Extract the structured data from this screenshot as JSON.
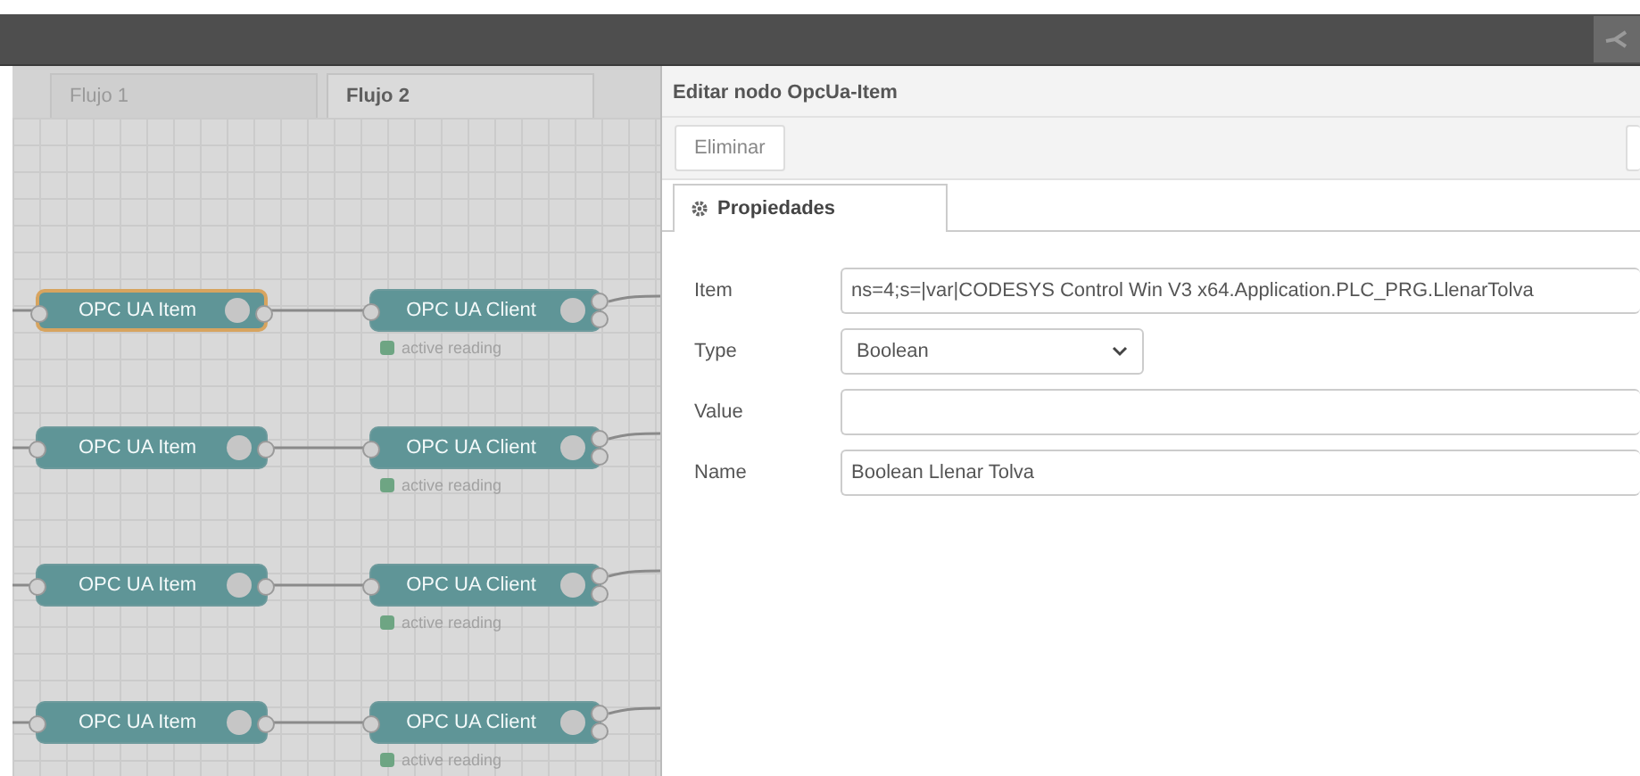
{
  "flow_tabs": [
    {
      "label": "Flujo 1",
      "selected": false
    },
    {
      "label": "Flujo 2",
      "selected": true
    }
  ],
  "flows": [
    {
      "item": {
        "label": "OPC UA Item",
        "selected": true
      },
      "client": {
        "label": "OPC UA Client",
        "selected": false,
        "status": "active reading"
      }
    },
    {
      "item": {
        "label": "OPC UA Item",
        "selected": false
      },
      "client": {
        "label": "OPC UA Client",
        "selected": false,
        "status": "active reading"
      }
    },
    {
      "item": {
        "label": "OPC UA Item",
        "selected": false
      },
      "client": {
        "label": "OPC UA Client",
        "selected": false,
        "status": "active reading"
      }
    },
    {
      "item": {
        "label": "OPC UA Item",
        "selected": false
      },
      "client": {
        "label": "OPC UA Client",
        "selected": false,
        "status": "active reading"
      }
    }
  ],
  "editor": {
    "title": "Editar nodo OpcUa-Item",
    "delete_button": "Eliminar",
    "tabs": [
      {
        "label": "Propiedades",
        "selected": true
      }
    ],
    "fields": [
      {
        "label": "Item",
        "kind": "text",
        "value": "ns=4;s=|var|CODESYS Control Win V3 x64.Application.PLC_PRG.LlenarTolva"
      },
      {
        "label": "Type",
        "kind": "select",
        "value": "Boolean"
      },
      {
        "label": "Value",
        "kind": "text"
      },
      {
        "label": "Name",
        "kind": "text",
        "value": "Boolean Llenar Tolva"
      }
    ]
  }
}
